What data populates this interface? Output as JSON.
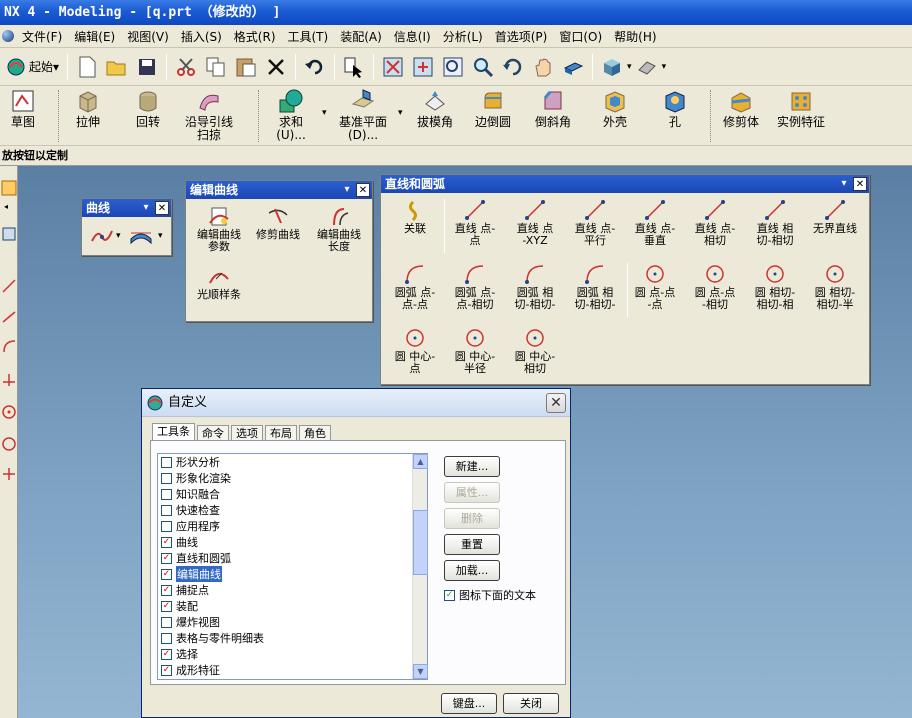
{
  "window": {
    "title": "NX 4 - Modeling - [q.prt （修改的） ]"
  },
  "menubar": {
    "items": [
      "文件(F)",
      "编辑(E)",
      "视图(V)",
      "插入(S)",
      "格式(R)",
      "工具(T)",
      "装配(A)",
      "信息(I)",
      "分析(L)",
      "首选项(P)",
      "窗口(O)",
      "帮助(H)"
    ]
  },
  "toolbar1": {
    "start_label": "起始",
    "start_arrow": "▾"
  },
  "toolbar2": {
    "sketch": "草图",
    "extrude": "拉伸",
    "revolve": "回转",
    "sweep_line1": "沿导引线",
    "sweep_line2": "扫掠",
    "unite_line1": "求和",
    "unite_line2": "(U)...",
    "datum_line1": "基准平面",
    "datum_line2": "(D)...",
    "draft": "拔模角",
    "edge_blend": "边倒圆",
    "chamfer": "倒斜角",
    "shell": "外壳",
    "hole": "孔",
    "trim_body": "修剪体",
    "instance": "实例特征"
  },
  "status": {
    "text": "放按钮以定制"
  },
  "curve_panel": {
    "title": "曲线"
  },
  "edit_curve_panel": {
    "title": "编辑曲线",
    "param_line1": "编辑曲线",
    "param_line2": "参数",
    "trim": "修剪曲线",
    "length_line1": "编辑曲线",
    "length_line2": "长度",
    "smooth": "光顺样条"
  },
  "line_arc_panel": {
    "title": "直线和圆弧",
    "buttons": [
      {
        "l1": "关联",
        "l2": ""
      },
      {
        "l1": "直线 点-",
        "l2": "点"
      },
      {
        "l1": "直线 点",
        "l2": "-XYZ"
      },
      {
        "l1": "直线 点-",
        "l2": "平行"
      },
      {
        "l1": "直线 点-",
        "l2": "垂直"
      },
      {
        "l1": "直线 点-",
        "l2": "相切"
      },
      {
        "l1": "直线 相",
        "l2": "切-相切"
      },
      {
        "l1": "无界直线",
        "l2": ""
      },
      {
        "l1": "圆弧 点-",
        "l2": "点-点"
      },
      {
        "l1": "圆弧 点-",
        "l2": "点-相切"
      },
      {
        "l1": "圆弧 相",
        "l2": "切-相切-"
      },
      {
        "l1": "圆弧 相",
        "l2": "切-相切-"
      },
      {
        "l1": "圆 点-点",
        "l2": "-点"
      },
      {
        "l1": "圆 点-点",
        "l2": "-相切"
      },
      {
        "l1": "圆 相切-",
        "l2": "相切-相"
      },
      {
        "l1": "圆 相切-",
        "l2": "相切-半"
      },
      {
        "l1": "圆 中心-",
        "l2": "点"
      },
      {
        "l1": "圆 中心-",
        "l2": "半径"
      },
      {
        "l1": "圆 中心-",
        "l2": "相切"
      }
    ]
  },
  "dialog": {
    "title": "自定义",
    "close": "✕",
    "tabs": [
      "工具条",
      "命令",
      "选项",
      "布局",
      "角色"
    ],
    "list": [
      {
        "label": "形状分析",
        "checked": false
      },
      {
        "label": "形象化渲染",
        "checked": false
      },
      {
        "label": "知识融合",
        "checked": false
      },
      {
        "label": "快速检查",
        "checked": false
      },
      {
        "label": "应用程序",
        "checked": false
      },
      {
        "label": "曲线",
        "checked": true
      },
      {
        "label": "直线和圆弧",
        "checked": true
      },
      {
        "label": "编辑曲线",
        "checked": true,
        "selected": true
      },
      {
        "label": "捕捉点",
        "checked": true
      },
      {
        "label": "装配",
        "checked": true
      },
      {
        "label": "爆炸视图",
        "checked": false
      },
      {
        "label": "表格与零件明细表",
        "checked": false
      },
      {
        "label": "选择",
        "checked": true
      },
      {
        "label": "成形特征",
        "checked": true
      }
    ],
    "btn_new": "新建...",
    "btn_props": "属性...",
    "btn_delete": "删除",
    "btn_reset": "重置",
    "btn_load": "加载...",
    "text_below_label": "图标下面的文本",
    "btn_keyboard": "键盘...",
    "btn_close": "关闭"
  }
}
